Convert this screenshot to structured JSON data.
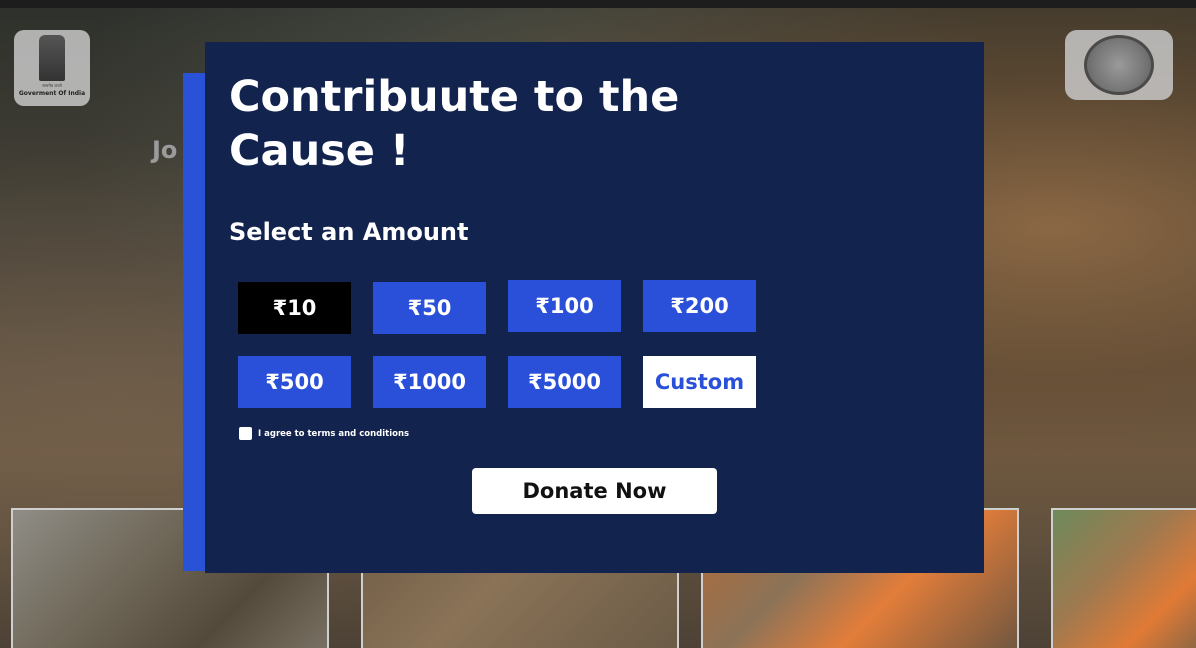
{
  "header": {
    "left_emblem_small_text": "सत्यमेव जयते",
    "left_emblem_caption": "Goverment Of India"
  },
  "background": {
    "partial_text": "Jo"
  },
  "modal": {
    "title": "Contribuute to the Cause !",
    "subtitle": "Select an Amount",
    "amounts": [
      {
        "label": "₹10",
        "selected": true
      },
      {
        "label": "₹50",
        "selected": false
      },
      {
        "label": "₹100",
        "selected": false
      },
      {
        "label": "₹200",
        "selected": false
      },
      {
        "label": "₹500",
        "selected": false
      },
      {
        "label": "₹1000",
        "selected": false
      },
      {
        "label": "₹5000",
        "selected": false
      },
      {
        "label": "Custom",
        "selected": false
      }
    ],
    "terms_label": "I agree to terms and conditions",
    "terms_checked": false,
    "donate_label": "Donate Now"
  },
  "colors": {
    "modal_bg": "#12234e",
    "accent": "#2a4fd8",
    "selected_bg": "#000000",
    "custom_bg": "#ffffff"
  }
}
